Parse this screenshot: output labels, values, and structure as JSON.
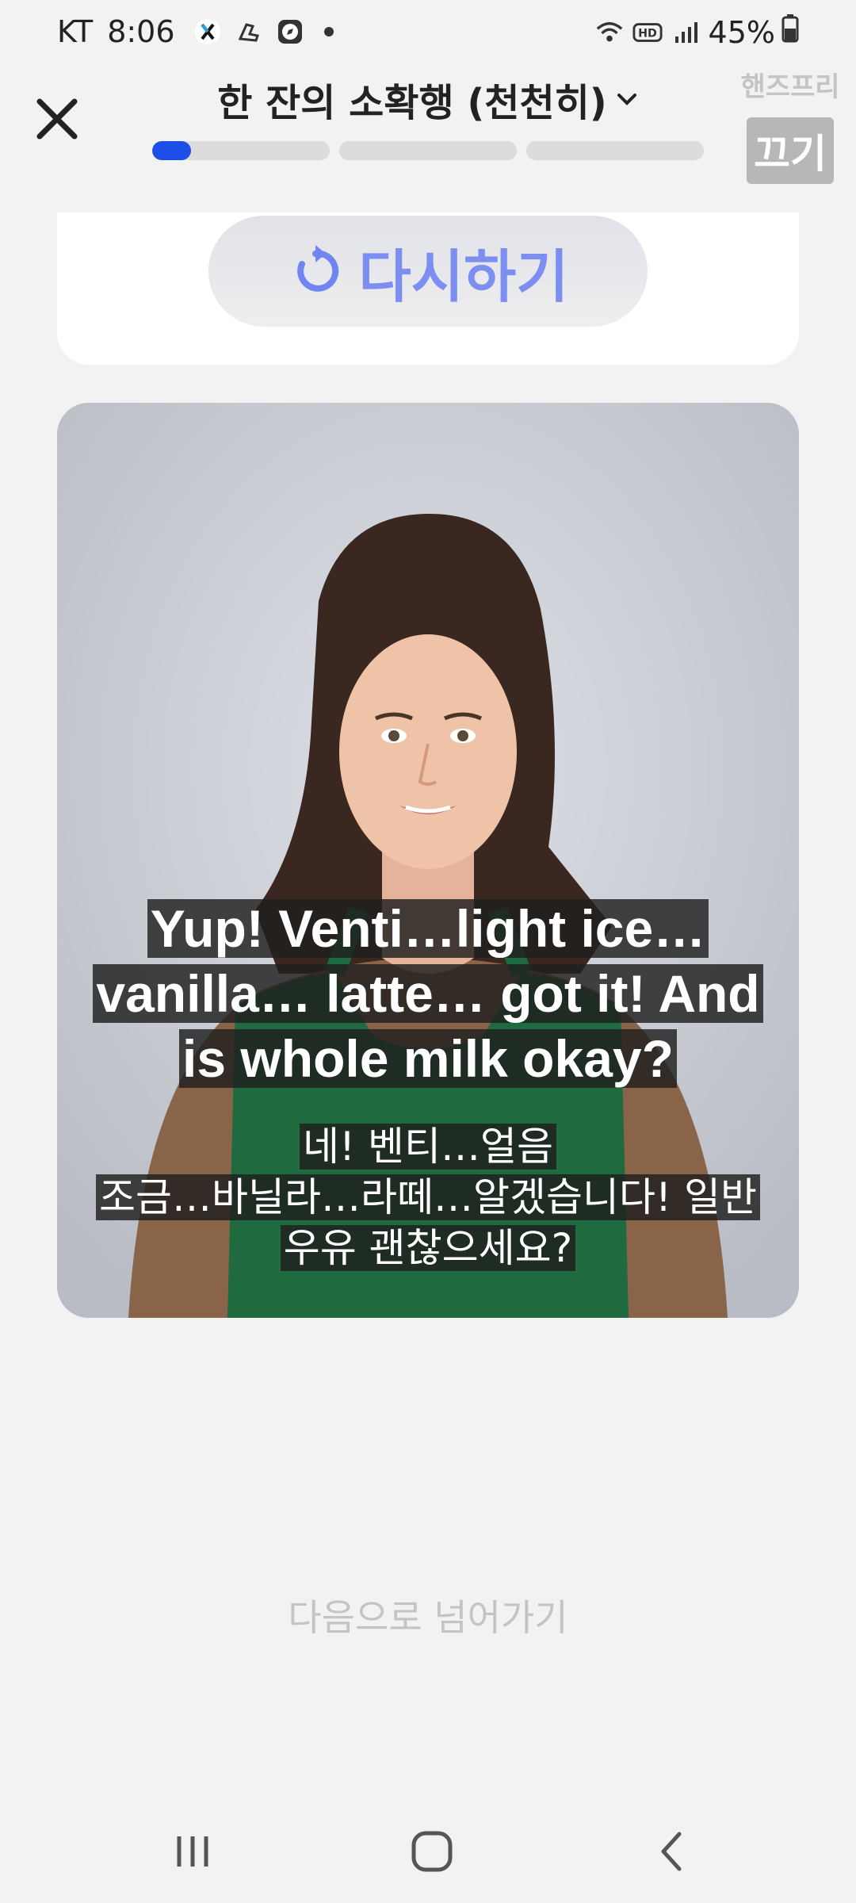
{
  "status_bar": {
    "carrier": "KT",
    "time": "8:06",
    "battery": "45%",
    "icons": [
      "x-app-icon",
      "sneaker-icon",
      "compass-icon",
      "wifi-icon",
      "hd-icon",
      "signal-icon",
      "battery-icon"
    ]
  },
  "header": {
    "title": "한 잔의 소확행 (천천히)",
    "progress": [
      0.22,
      0,
      0
    ]
  },
  "watermark": {
    "top_text": "핸즈프리",
    "button_text": "끄기"
  },
  "retry": {
    "label": "다시하기"
  },
  "subtitles": {
    "en": [
      "Yup! Venti…light ice…",
      "vanilla… latte… got it! And",
      "is whole milk okay?"
    ],
    "ko": [
      "네! 벤티…얼음",
      "조금…바닐라…라떼…알겠습니다! 일반",
      "우유 괜찮으세요?"
    ]
  },
  "next": {
    "label": "다음으로 넘어가기"
  },
  "colors": {
    "accent": "#1d4fe8",
    "retry_text": "#7c8ef0",
    "background": "#f2f2f2"
  }
}
